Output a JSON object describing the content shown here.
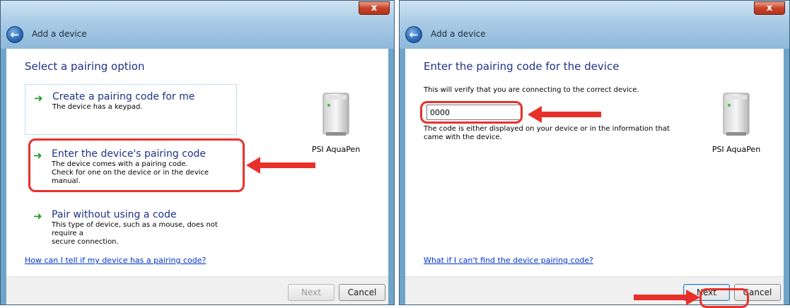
{
  "left_dialog": {
    "close_label": "x",
    "title": "Add a device",
    "heading": "Select a pairing option",
    "options": [
      {
        "title": "Create a pairing code for me",
        "desc_lines": [
          "The device has a keypad."
        ]
      },
      {
        "title": "Enter the device's pairing code",
        "desc_lines": [
          "The device comes with a pairing code.",
          "Check for one on the device or in the device manual."
        ]
      },
      {
        "title": "Pair without using a code",
        "desc_lines": [
          "This type of device, such as a mouse, does not require a",
          "secure connection."
        ]
      }
    ],
    "device_name": "PSI AquaPen",
    "help_link": "How can I tell if my device has a pairing code?",
    "buttons": {
      "next": "Next",
      "cancel": "Cancel"
    }
  },
  "right_dialog": {
    "close_label": "x",
    "title": "Add a device",
    "heading": "Enter the pairing code for the device",
    "instruction": "This will verify that you are connecting to the correct device.",
    "code_value": "0000",
    "hint_lines": [
      "The code is either displayed on your device or in the information that",
      "came with the device."
    ],
    "device_name": "PSI AquaPen",
    "help_link": "What if I can't find the device pairing code?",
    "buttons": {
      "next": "Next",
      "cancel": "Cancel"
    }
  },
  "icons": {
    "arrow": "green-arrow-icon",
    "back": "back-arrow-icon",
    "device": "device-tower-icon"
  },
  "colors": {
    "annotation_red": "#e8302a",
    "heading_blue": "#1e3287",
    "link_blue": "#0033cc",
    "arrow_green": "#1e9b2a"
  }
}
